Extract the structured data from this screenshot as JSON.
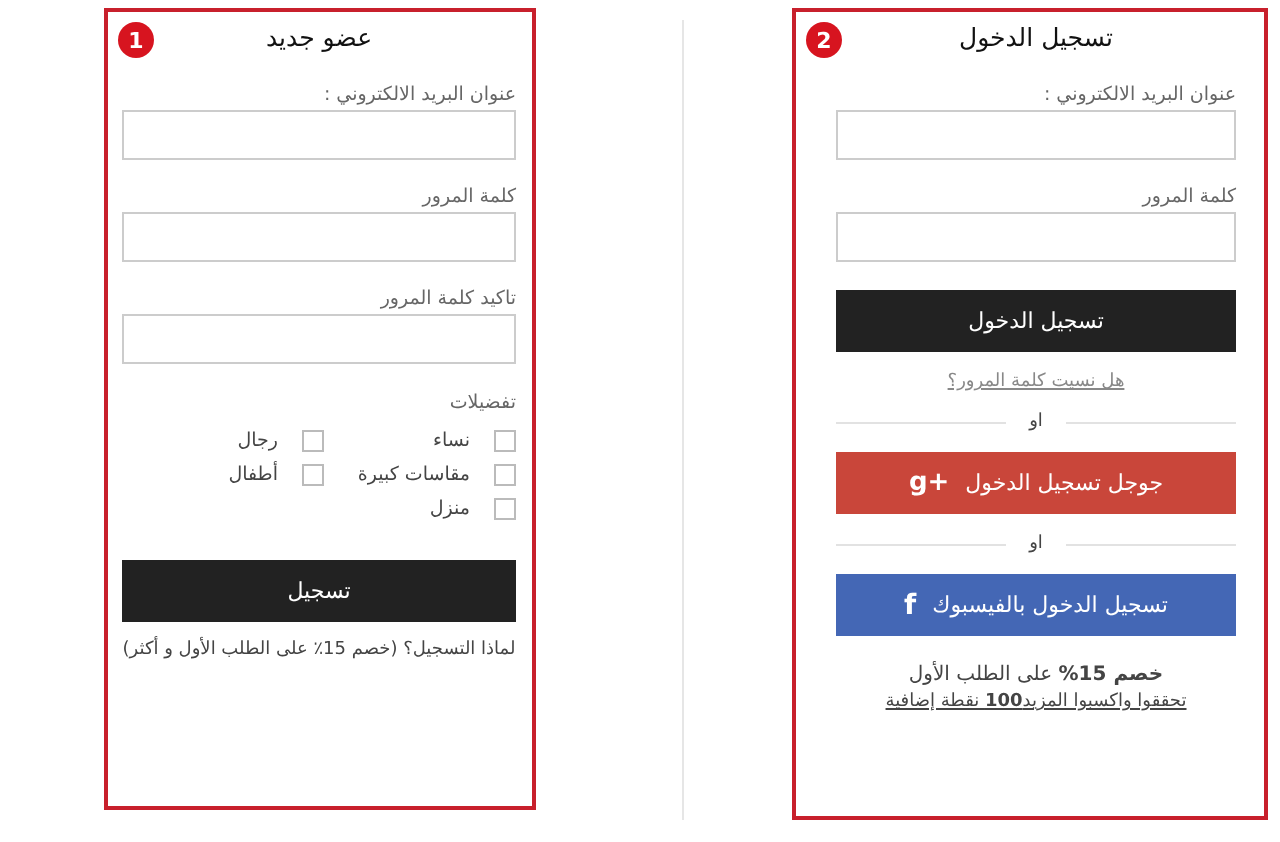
{
  "register": {
    "badge": "1",
    "title": "عضو جديد",
    "fields": [
      {
        "label": "عنوان البريد الالكتروني :"
      },
      {
        "label": "كلمة المرور"
      },
      {
        "label": "تاكيد كلمة المرور"
      }
    ],
    "preferences_label": "تفضيلات",
    "preferences": [
      {
        "label": "نساء",
        "checked": false
      },
      {
        "label": "رجال",
        "checked": false
      },
      {
        "label": "مقاسات كبيرة",
        "checked": false
      },
      {
        "label": "أطفال",
        "checked": false
      },
      {
        "label": "منزل",
        "checked": false
      }
    ],
    "submit": "تسجيل",
    "note": "لماذا التسجيل؟ (خصم 15٪ على الطلب الأول و أكثر)"
  },
  "login": {
    "badge": "2",
    "title": "تسجيل الدخول",
    "fields": [
      {
        "label": "عنوان البريد الالكتروني :"
      },
      {
        "label": "كلمة المرور"
      }
    ],
    "submit": "تسجيل الدخول",
    "forgot": "هل نسيت كلمة المرور؟",
    "social": [
      {
        "kind": "google",
        "separator": "او",
        "label": "جوجل تسجيل الدخول",
        "icon": "g+"
      },
      {
        "kind": "facebook",
        "separator": "او",
        "label": "تسجيل الدخول بالفيسبوك",
        "icon": "f"
      }
    ],
    "promo": "**خصم 15%** على الطلب الأول",
    "promo_link": "تحققوا واكسبوا المزيد**100** نقطة إضافية"
  }
}
